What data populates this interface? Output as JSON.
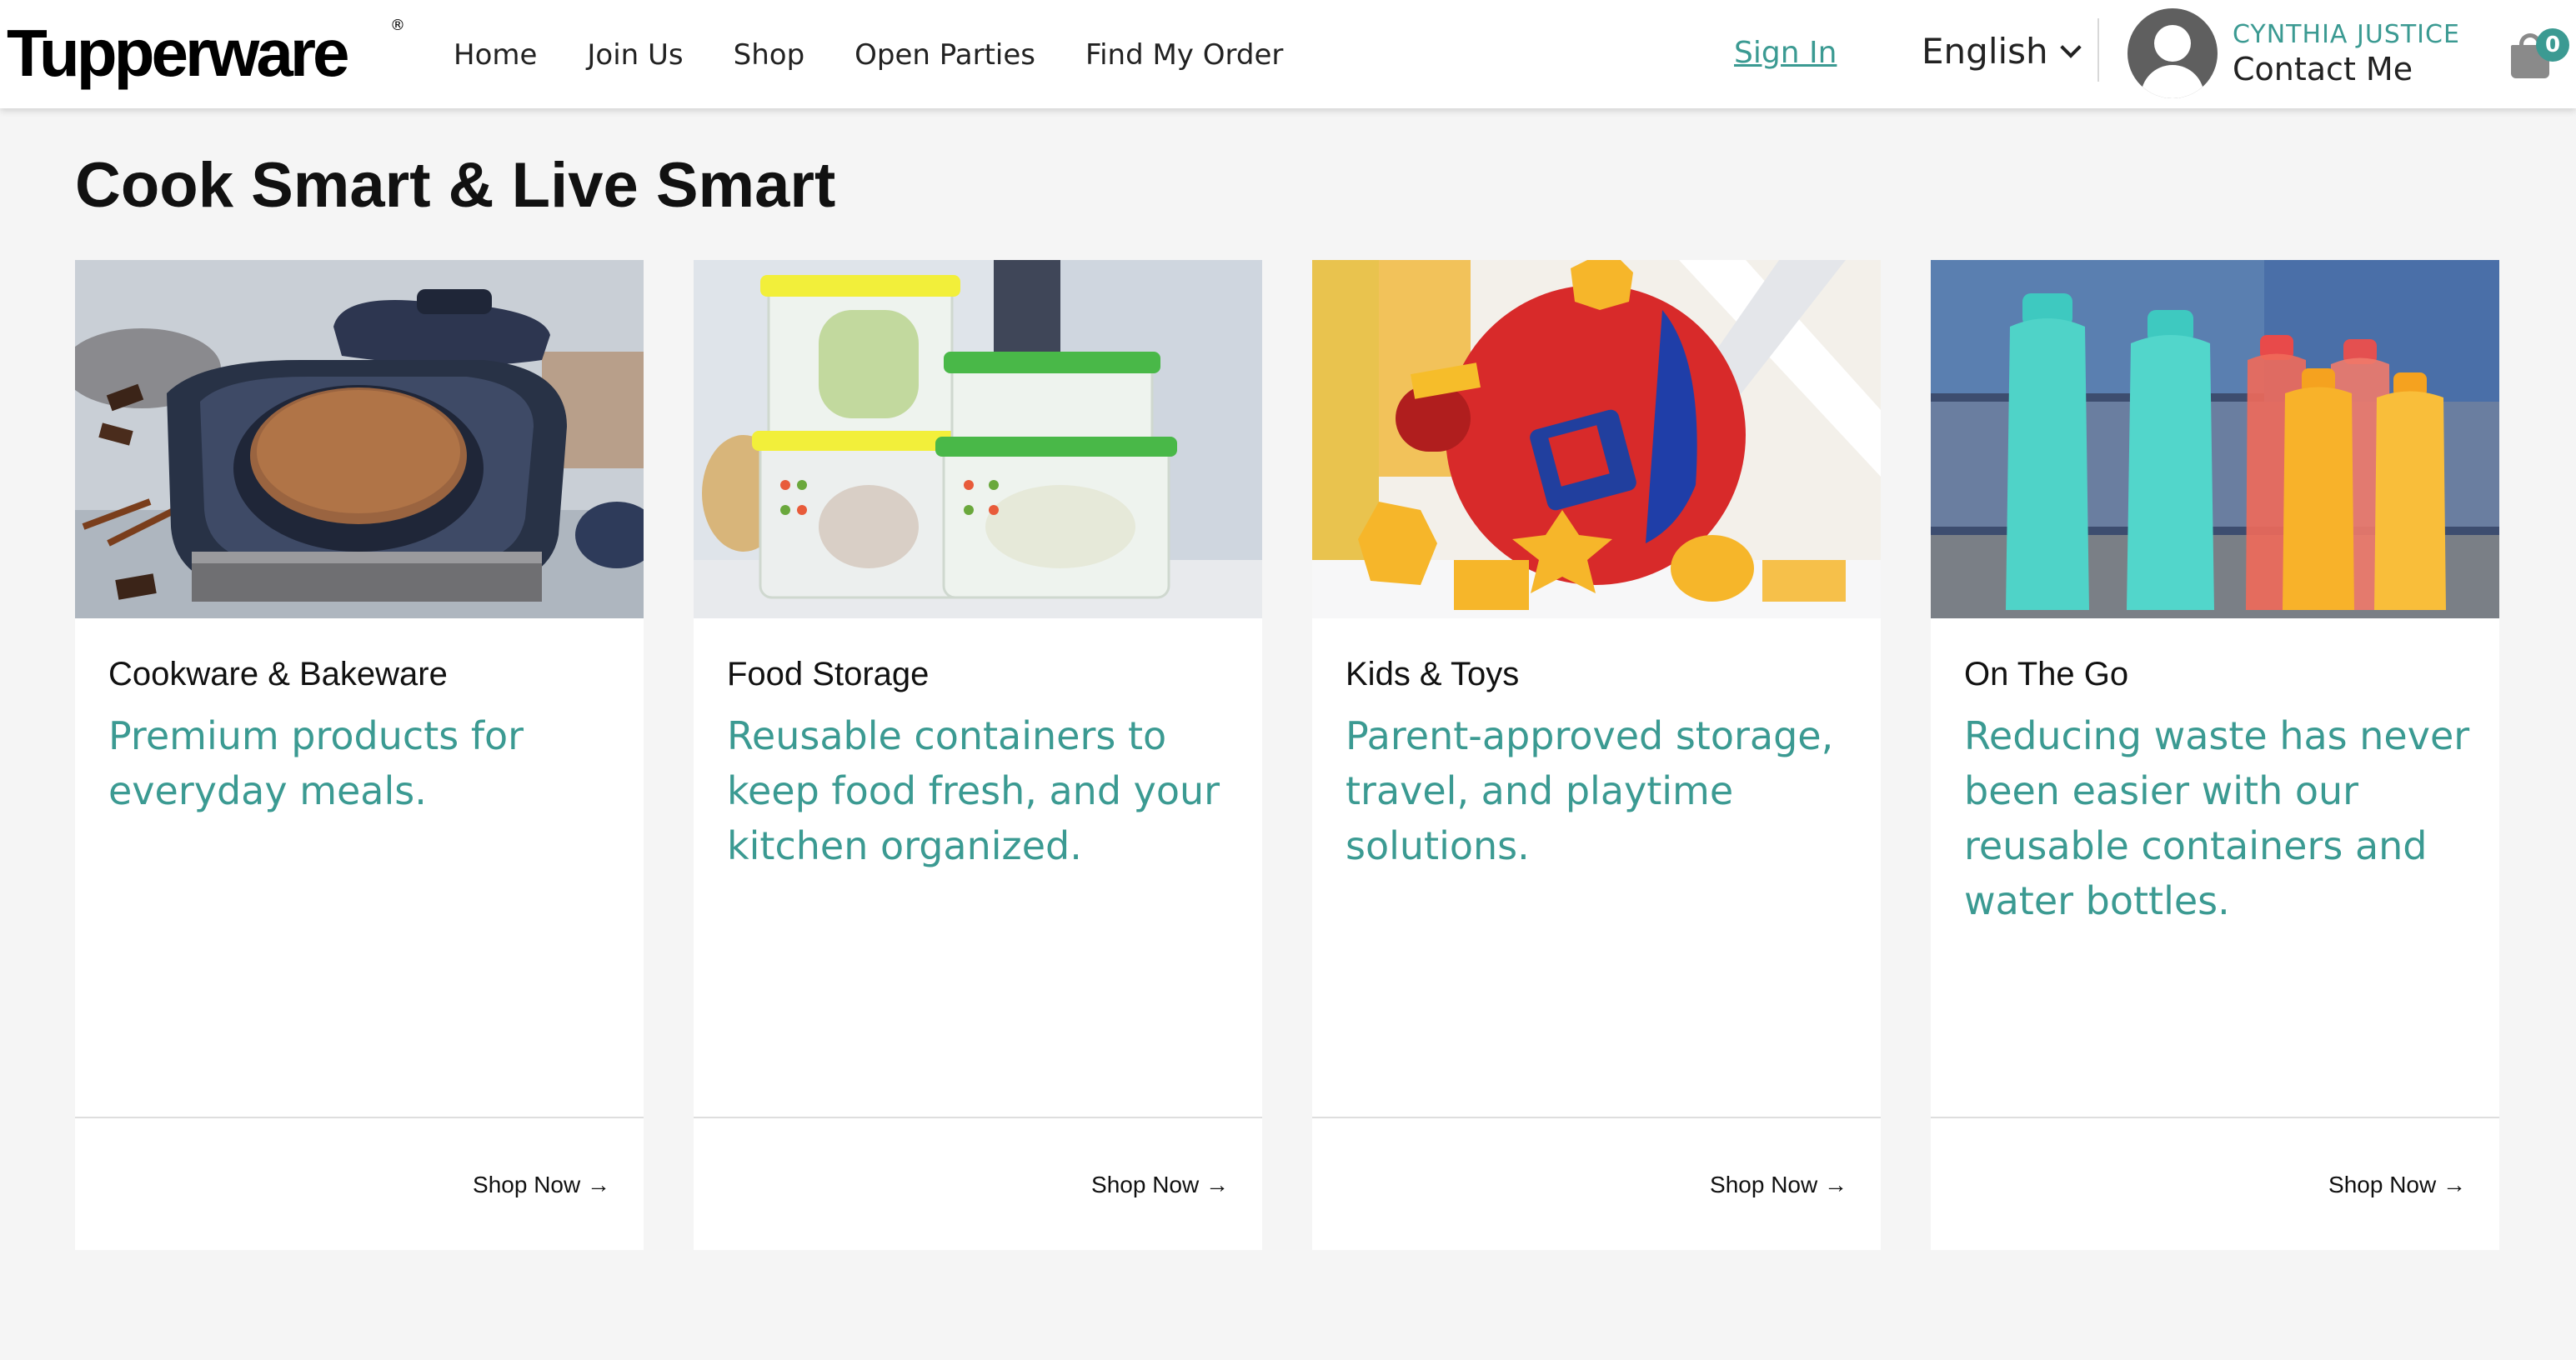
{
  "header": {
    "logo": "Tupperware",
    "logo_mark": "®",
    "nav": [
      {
        "label": "Home"
      },
      {
        "label": "Join Us"
      },
      {
        "label": "Shop"
      },
      {
        "label": "Open Parties"
      },
      {
        "label": "Find My Order"
      }
    ],
    "sign_in": "Sign In",
    "language": "English",
    "user_name": "CYNTHIA JUSTICE",
    "contact": "Contact Me",
    "cart_count": "0"
  },
  "main": {
    "title": "Cook Smart & Live Smart",
    "cards": [
      {
        "category": "Cookware & Bakeware",
        "description": "Premium products for everyday meals.",
        "cta": "Shop Now →",
        "image_icon": "cookware-photo"
      },
      {
        "category": "Food Storage",
        "description": "Reusable containers to keep food fresh, and your kitchen organized.",
        "cta": "Shop Now →",
        "image_icon": "food-storage-photo"
      },
      {
        "category": "Kids & Toys",
        "description": "Parent-approved storage, travel, and playtime solutions.",
        "cta": "Shop Now →",
        "image_icon": "kids-toys-photo"
      },
      {
        "category": "On The Go",
        "description": "Reducing waste has never been easier with our reusable containers and water bottles.",
        "cta": "Shop Now →",
        "image_icon": "water-bottles-photo"
      }
    ]
  },
  "colors": {
    "accent": "#3b9a92",
    "background": "#f5f5f5",
    "card": "#ffffff"
  }
}
